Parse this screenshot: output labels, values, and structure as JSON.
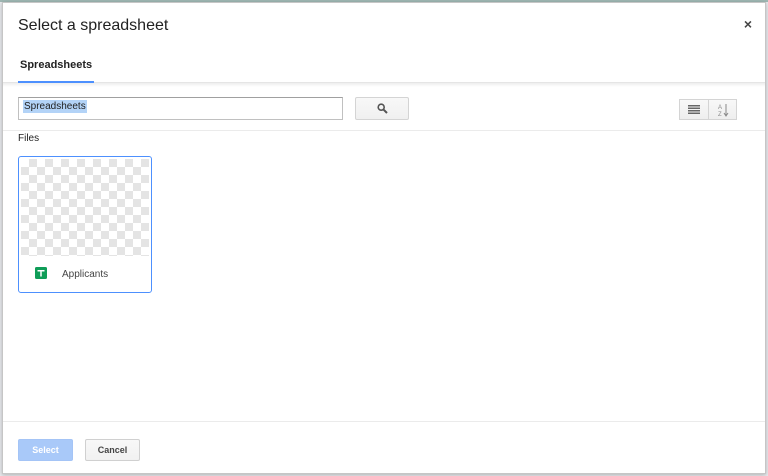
{
  "dialog": {
    "title": "Select a spreadsheet",
    "close_label": "×"
  },
  "tabs": [
    {
      "label": "Spreadsheets",
      "active": true
    }
  ],
  "search": {
    "value": "Spreadsheets",
    "button_icon": "search-icon"
  },
  "view_controls": {
    "list_icon": "list-view-icon",
    "sort_icon": "sort-az-icon"
  },
  "files_section": {
    "label": "Files",
    "items": [
      {
        "name": "Applicants",
        "type_icon": "google-sheets-icon"
      }
    ]
  },
  "footer": {
    "select_label": "Select",
    "cancel_label": "Cancel"
  },
  "colors": {
    "accent": "#4d90fe",
    "select_disabled": "#a9c9f9",
    "sheets_green": "#0f9d58"
  }
}
